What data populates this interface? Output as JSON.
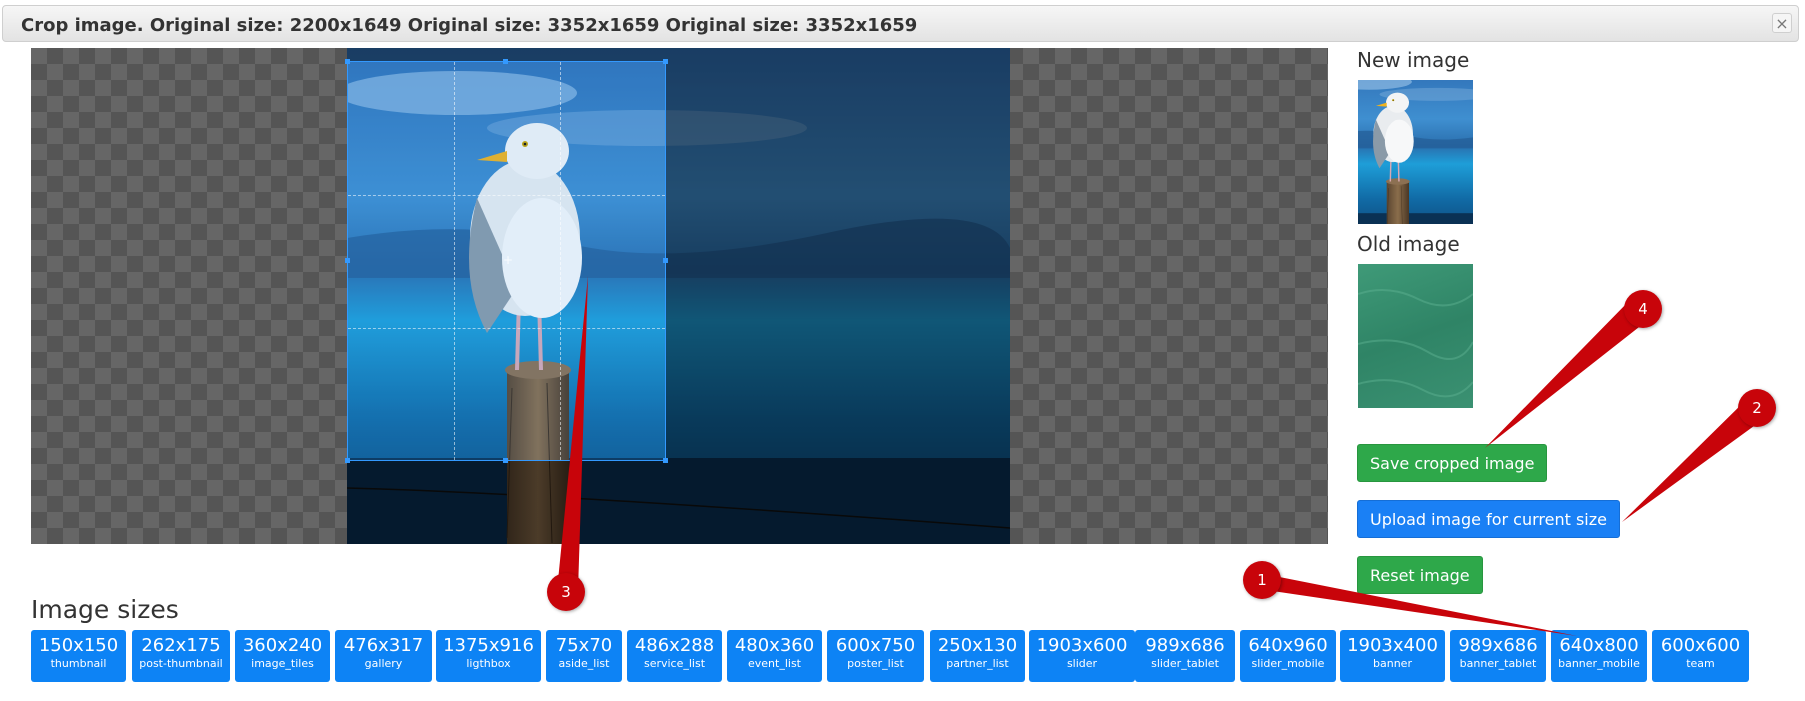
{
  "dialog": {
    "title": "Crop image. Original size: 2200x1649 Original size: 3352x1659 Original size: 3352x1659",
    "close_glyph": "×"
  },
  "preview": {
    "new_label": "New image",
    "old_label": "Old image"
  },
  "actions": {
    "save": "Save cropped image",
    "upload": "Upload image for current size",
    "reset": "Reset image"
  },
  "sizes": {
    "heading": "Image sizes",
    "items": [
      {
        "dim": "150x150",
        "name": "thumbnail"
      },
      {
        "dim": "262x175",
        "name": "post-thumbnail"
      },
      {
        "dim": "360x240",
        "name": "image_tiles"
      },
      {
        "dim": "476x317",
        "name": "gallery"
      },
      {
        "dim": "1375x916",
        "name": "ligthbox"
      },
      {
        "dim": "75x70",
        "name": "aside_list"
      },
      {
        "dim": "486x288",
        "name": "service_list"
      },
      {
        "dim": "480x360",
        "name": "event_list"
      },
      {
        "dim": "600x750",
        "name": "poster_list"
      },
      {
        "dim": "250x130",
        "name": "partner_list"
      },
      {
        "dim": "1903x600",
        "name": "slider"
      },
      {
        "dim": "989x686",
        "name": "slider_tablet"
      },
      {
        "dim": "640x960",
        "name": "slider_mobile"
      },
      {
        "dim": "1903x400",
        "name": "banner"
      },
      {
        "dim": "989x686",
        "name": "banner_tablet"
      },
      {
        "dim": "640x800",
        "name": "banner_mobile"
      },
      {
        "dim": "600x600",
        "name": "team"
      }
    ]
  },
  "callouts": [
    "1",
    "2",
    "3",
    "4"
  ],
  "colors": {
    "primary": "#0d83f5",
    "success": "#2ea84a",
    "callout": "#c8040a",
    "crop_border": "#3399ff"
  }
}
